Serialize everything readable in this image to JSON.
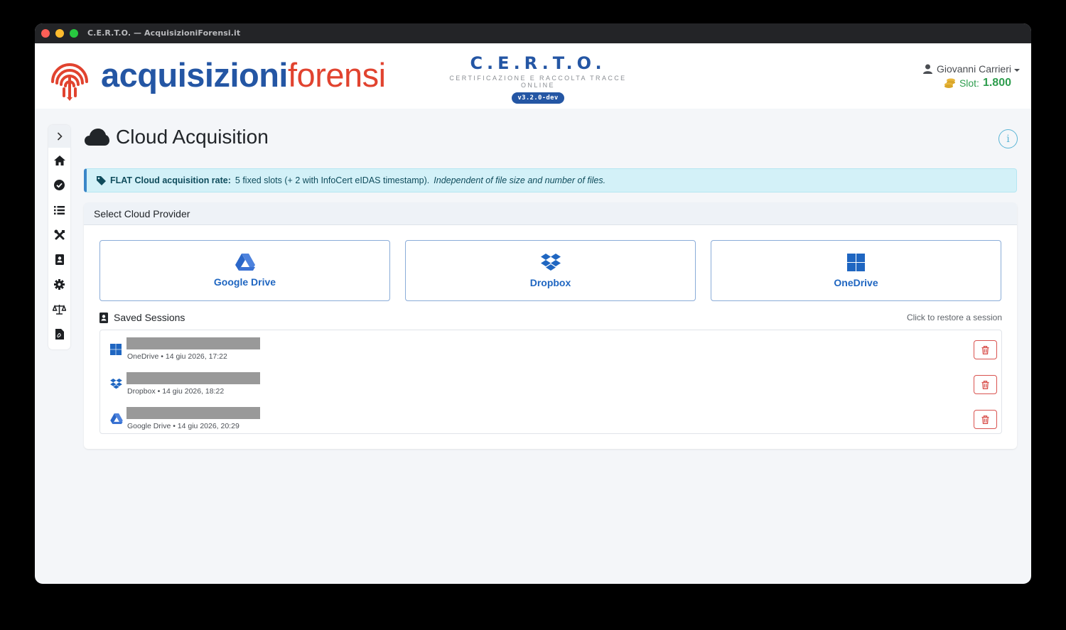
{
  "window": {
    "title": "C.E.R.T.O. — AcquisizioniForensi.it"
  },
  "header": {
    "logo_part1": "acquisizioni",
    "logo_part2": "forensi",
    "brand_title": "C.E.R.T.O.",
    "brand_subtitle": "CERTIFICAZIONE E RACCOLTA TRACCE ONLINE",
    "version": "v3.2.0-dev",
    "user_name": "Giovanni Carrieri",
    "slot_label": "Slot:",
    "slot_value": "1.800"
  },
  "sidebar": {
    "items": [
      {
        "icon": "home-icon"
      },
      {
        "icon": "check-circle-icon"
      },
      {
        "icon": "list-icon"
      },
      {
        "icon": "tools-icon"
      },
      {
        "icon": "address-book-icon"
      },
      {
        "icon": "gear-icon"
      },
      {
        "icon": "balance-scale-icon"
      },
      {
        "icon": "file-pdf-icon"
      }
    ]
  },
  "page": {
    "title": "Cloud Acquisition"
  },
  "alert": {
    "bold": "FLAT Cloud acquisition rate:",
    "text": "5 fixed slots (+ 2 with InfoCert eIDAS timestamp).",
    "italic": "Independent of file size and number of files."
  },
  "provider_card": {
    "heading": "Select Cloud Provider",
    "providers": [
      {
        "label": "Google Drive",
        "icon": "google-drive-icon"
      },
      {
        "label": "Dropbox",
        "icon": "dropbox-icon"
      },
      {
        "label": "OneDrive",
        "icon": "onedrive-icon"
      }
    ]
  },
  "sessions": {
    "title": "Saved Sessions",
    "hint": "Click to restore a session",
    "items": [
      {
        "provider_icon": "onedrive-icon",
        "meta": "OneDrive • 14 giu 2026, 17:22"
      },
      {
        "provider_icon": "dropbox-icon",
        "meta": "Dropbox • 14 giu 2026, 18:22"
      },
      {
        "provider_icon": "google-drive-icon",
        "meta": "Google Drive • 14 giu 2026, 20:29"
      }
    ]
  },
  "colors": {
    "brand_blue": "#2456a4",
    "brand_red": "#e1432f",
    "provider_blue": "#1f66c1",
    "slot_green": "#2e9d4e",
    "alert_bg": "#d3f1f8",
    "danger": "#d9534f"
  }
}
